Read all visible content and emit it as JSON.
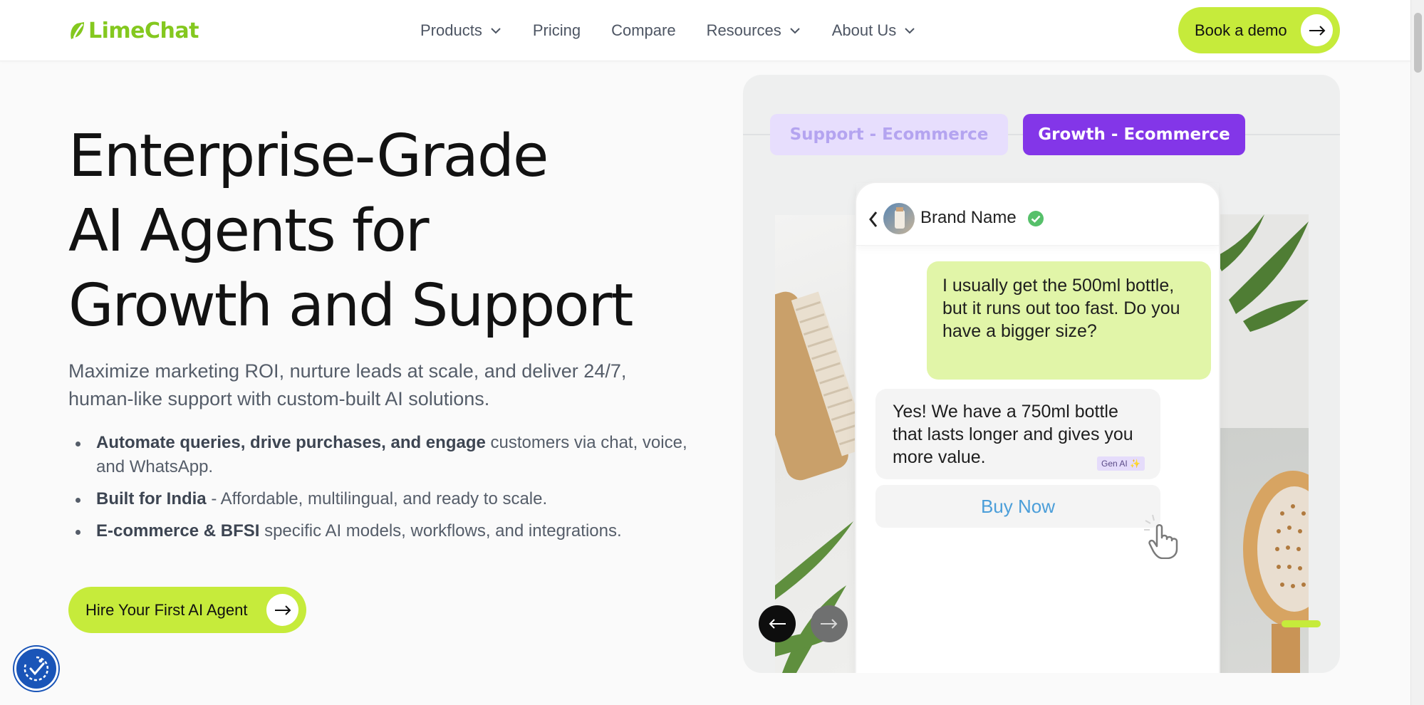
{
  "header": {
    "logo_text": "LimeChat",
    "nav": [
      {
        "label": "Products",
        "has_dropdown": true
      },
      {
        "label": "Pricing",
        "has_dropdown": false
      },
      {
        "label": "Compare",
        "has_dropdown": false
      },
      {
        "label": "Resources",
        "has_dropdown": true
      },
      {
        "label": "About Us",
        "has_dropdown": true
      }
    ],
    "cta_label": "Book a demo"
  },
  "hero": {
    "title_lines": [
      "Enterprise-Grade",
      "AI Agents for",
      "Growth and Support"
    ],
    "subtitle": "Maximize marketing ROI, nurture leads at scale, and deliver 24/7, human-like support with custom-built AI solutions.",
    "bullets": [
      {
        "bold": "Automate queries, drive purchases, and engage",
        "rest": " customers via chat, voice, and WhatsApp."
      },
      {
        "bold": "Built for India",
        "rest": " - Affordable, multilingual, and ready to scale."
      },
      {
        "bold": "E-commerce & BFSI",
        "rest": " specific AI models, workflows, and integrations."
      }
    ],
    "cta_label": "Hire Your First AI Agent"
  },
  "demo": {
    "tabs": [
      {
        "label": "Support - Ecommerce",
        "active": false
      },
      {
        "label": "Growth - Ecommerce",
        "active": true
      }
    ],
    "chat": {
      "brand_name": "Brand Name",
      "user_message": "I usually get the 500ml bottle, but it runs out too fast. Do you have a bigger size?",
      "bot_message": "Yes! We have a 750ml bottle that lasts longer and gives you more value.",
      "bot_badge": "Gen AI ✨",
      "button_label": "Buy Now"
    }
  },
  "colors": {
    "accent": "#c6eb3b",
    "logo": "#84c81f",
    "active_tab": "#8336e8",
    "inactive_tab": "#e7defd",
    "user_bubble": "#e1f5a8",
    "link_blue": "#4b9ed9",
    "a11y": "#1a55b8"
  },
  "icons": {
    "cta_arrow": "arrow-right-icon",
    "nav_dropdown": "chevron-down-icon",
    "a11y": "accessibility-icon",
    "verified": "verified-check-icon"
  }
}
